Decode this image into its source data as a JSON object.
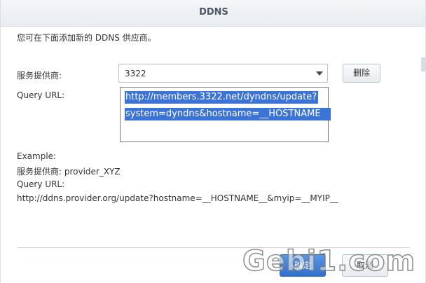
{
  "dialog": {
    "title": "DDNS",
    "intro": "您可在下面添加新的 DDNS 供应商。"
  },
  "form": {
    "provider_label": "服务提供商:",
    "provider_value": "3322",
    "delete_label": "删除",
    "query_url_label": "Query URL:",
    "query_url_line1": "http://members.3322.net/dyndns/update?",
    "query_url_line2": "system=dyndns&hostname=__HOSTNAME"
  },
  "example": {
    "heading": "Example:",
    "provider_line": "服务提供商: provider_XYZ",
    "query_label": "Query URL:",
    "query_value": "http://ddns.provider.org/update?hostname=__HOSTNAME__&myip=__MYIP__"
  },
  "footer": {
    "ok_label": "确定",
    "cancel_label": "取消"
  },
  "watermark": {
    "text": "Gebi1.com"
  },
  "colors": {
    "selection": "#3b73d6",
    "primary_button": "#2f6fce"
  }
}
